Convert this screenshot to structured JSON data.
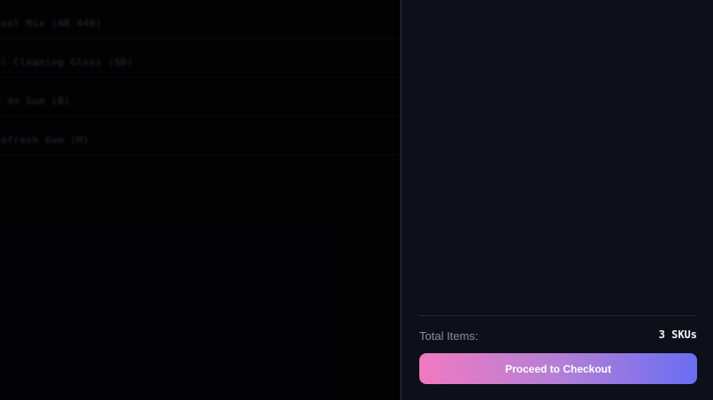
{
  "background_list": {
    "rows": [
      "ixel Mix (AR 440)",
      "al Cleaning Gloss (SD)",
      "n 4o Gum (B)",
      "tofresh Gum (M)"
    ]
  },
  "cart": {
    "total_label": "Total Items:",
    "total_value": "3 SKUs",
    "checkout_label": "Proceed to Checkout"
  },
  "colors": {
    "drawer_bg": "#0d1018",
    "button_gradient_start": "#f07ac0",
    "button_gradient_end": "#6a6ef2"
  }
}
